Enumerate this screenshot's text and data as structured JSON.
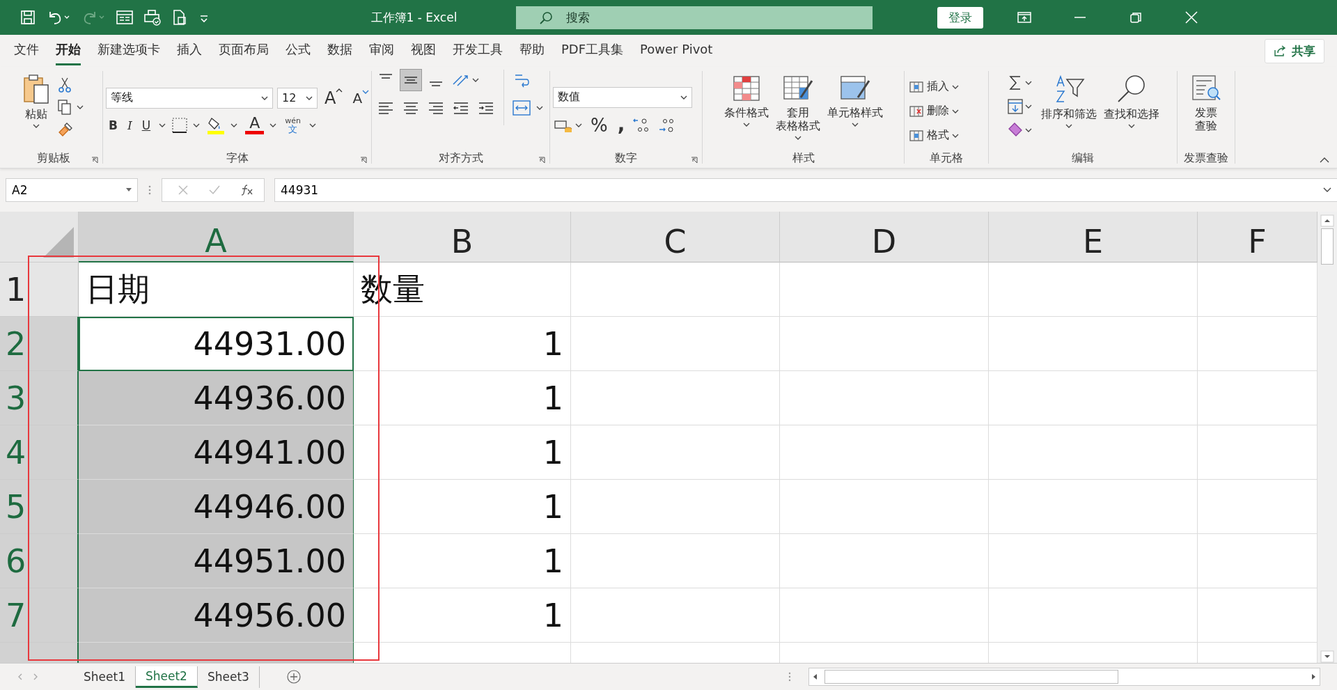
{
  "title_bar": {
    "title": "工作簿1  -  Excel",
    "search": {
      "placeholder": "搜索"
    },
    "sign_in": "登录"
  },
  "ribbon_tabs": [
    {
      "label": "文件",
      "selected": false
    },
    {
      "label": "开始",
      "selected": true
    },
    {
      "label": "新建选项卡",
      "selected": false
    },
    {
      "label": "插入",
      "selected": false
    },
    {
      "label": "页面布局",
      "selected": false
    },
    {
      "label": "公式",
      "selected": false
    },
    {
      "label": "数据",
      "selected": false
    },
    {
      "label": "审阅",
      "selected": false
    },
    {
      "label": "视图",
      "selected": false
    },
    {
      "label": "开发工具",
      "selected": false
    },
    {
      "label": "帮助",
      "selected": false
    },
    {
      "label": "PDF工具集",
      "selected": false
    },
    {
      "label": "Power Pivot",
      "selected": false
    }
  ],
  "share_button": "共享",
  "ribbon": {
    "clipboard": {
      "label": "剪贴板",
      "paste": "粘贴"
    },
    "font": {
      "label": "字体",
      "font_name": "等线",
      "font_size": "12",
      "bold": "B",
      "italic": "I",
      "underline": "U",
      "font_color_letter": "A",
      "grow_letter": "A",
      "shrink_letter": "A",
      "phonetic_top": "wén",
      "phonetic_bottom": "文"
    },
    "alignment": {
      "label": "对齐方式"
    },
    "number": {
      "label": "数字",
      "format": "数值",
      "percent": "%",
      "comma": ","
    },
    "styles": {
      "label": "样式",
      "items": [
        {
          "lines": [
            "条件格式"
          ]
        },
        {
          "lines": [
            "套用",
            "表格格式"
          ]
        },
        {
          "lines": [
            "单元格样式"
          ]
        }
      ]
    },
    "cells": {
      "label": "单元格",
      "items": [
        "插入",
        "删除",
        "格式"
      ]
    },
    "editing": {
      "label": "编辑",
      "sort": "排序和筛选",
      "find": "查找和选择"
    },
    "invoice": {
      "label": "发票查验",
      "lines": [
        "发票",
        "查验"
      ]
    }
  },
  "formula_bar": {
    "name_box": "A2",
    "formula": "44931"
  },
  "columns": [
    {
      "label": "A",
      "selected": true
    },
    {
      "label": "B",
      "selected": false
    },
    {
      "label": "C",
      "selected": false
    },
    {
      "label": "D",
      "selected": false
    },
    {
      "label": "E",
      "selected": false
    },
    {
      "label": "F",
      "selected": false
    }
  ],
  "rows": [
    {
      "header": "1",
      "selected": false,
      "cells": [
        {
          "text": "日期",
          "selected": false,
          "active": false,
          "kind": "text"
        },
        {
          "text": "数量",
          "selected": false,
          "active": false,
          "kind": "text"
        }
      ]
    },
    {
      "header": "2",
      "selected": true,
      "cells": [
        {
          "text": "44931.00",
          "selected": true,
          "active": true,
          "kind": "number"
        },
        {
          "text": "1",
          "selected": false,
          "active": false,
          "kind": "number"
        }
      ]
    },
    {
      "header": "3",
      "selected": true,
      "cells": [
        {
          "text": "44936.00",
          "selected": true,
          "active": false,
          "kind": "number"
        },
        {
          "text": "1",
          "selected": false,
          "active": false,
          "kind": "number"
        }
      ]
    },
    {
      "header": "4",
      "selected": true,
      "cells": [
        {
          "text": "44941.00",
          "selected": true,
          "active": false,
          "kind": "number"
        },
        {
          "text": "1",
          "selected": false,
          "active": false,
          "kind": "number"
        }
      ]
    },
    {
      "header": "5",
      "selected": true,
      "cells": [
        {
          "text": "44946.00",
          "selected": true,
          "active": false,
          "kind": "number"
        },
        {
          "text": "1",
          "selected": false,
          "active": false,
          "kind": "number"
        }
      ]
    },
    {
      "header": "6",
      "selected": true,
      "cells": [
        {
          "text": "44951.00",
          "selected": true,
          "active": false,
          "kind": "number"
        },
        {
          "text": "1",
          "selected": false,
          "active": false,
          "kind": "number"
        }
      ]
    },
    {
      "header": "7",
      "selected": true,
      "cells": [
        {
          "text": "44956.00",
          "selected": true,
          "active": false,
          "kind": "number"
        },
        {
          "text": "1",
          "selected": false,
          "active": false,
          "kind": "number"
        }
      ]
    }
  ],
  "annotation": {
    "kind": "rectangle",
    "color": "#e8383d"
  },
  "sheets": [
    {
      "label": "Sheet1",
      "selected": false
    },
    {
      "label": "Sheet2",
      "selected": true
    },
    {
      "label": "Sheet3",
      "selected": false
    }
  ]
}
